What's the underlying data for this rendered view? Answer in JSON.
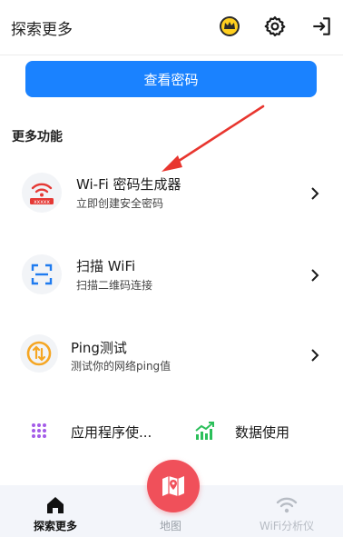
{
  "header": {
    "title": "探索更多"
  },
  "view_password_button": "查看密码",
  "section_title": "更多功能",
  "features": [
    {
      "title": "Wi-Fi 密码生成器",
      "subtitle": "立即创建安全密码"
    },
    {
      "title": "扫描 WiFi",
      "subtitle": "扫描二维码连接"
    },
    {
      "title": "Ping测试",
      "subtitle": "测试你的网络ping值"
    }
  ],
  "grid": [
    {
      "label": "应用程序使..."
    },
    {
      "label": "数据使用"
    }
  ],
  "tabs": [
    {
      "label": "探索更多",
      "active": true
    },
    {
      "label": "地图",
      "active": false
    },
    {
      "label": "WiFi分析仪",
      "active": false
    }
  ],
  "colors": {
    "accent": "#1a82ff",
    "fab": "#f0505a",
    "annotation_arrow": "#e8362f"
  }
}
